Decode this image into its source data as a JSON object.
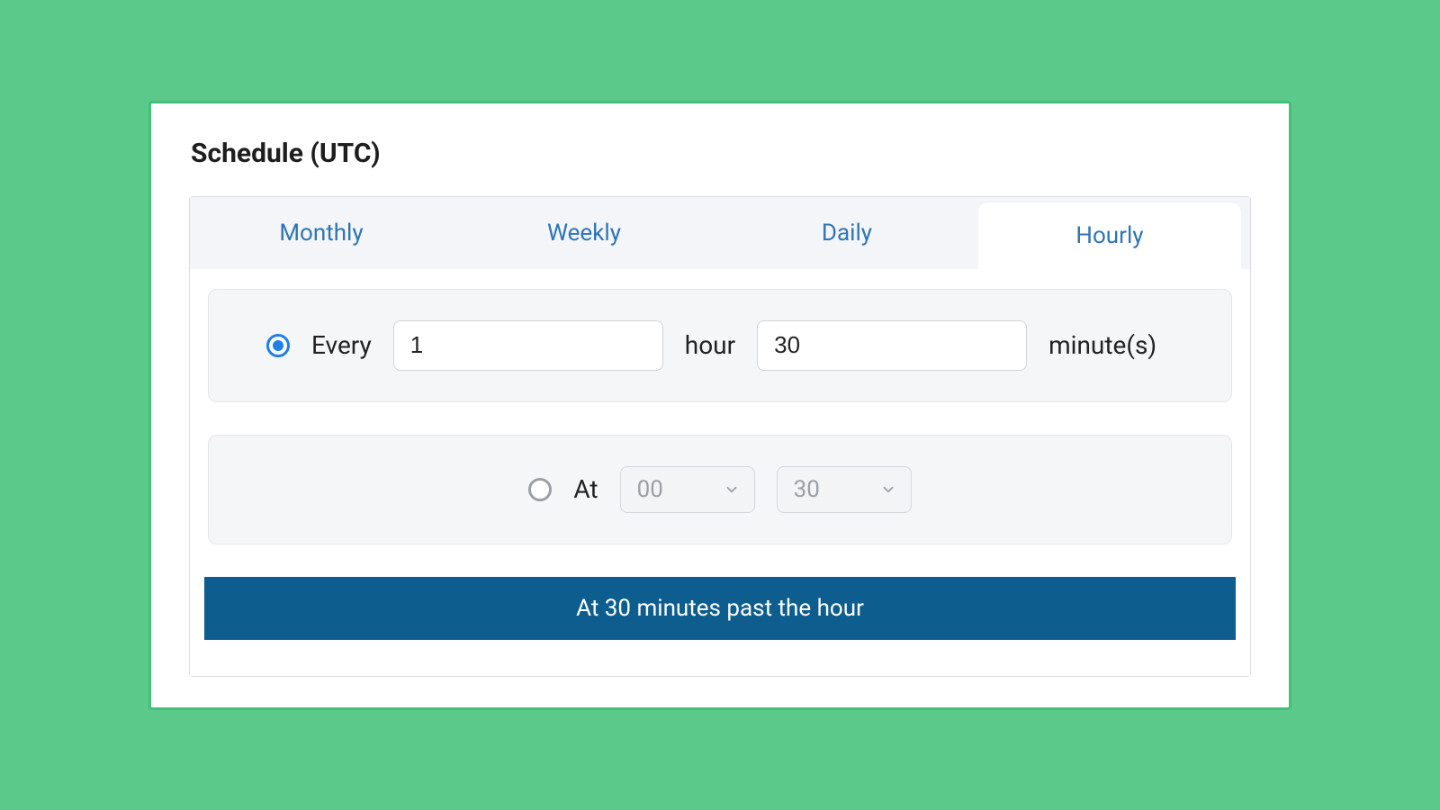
{
  "title": "Schedule (UTC)",
  "tabs": [
    {
      "label": "Monthly",
      "active": false
    },
    {
      "label": "Weekly",
      "active": false
    },
    {
      "label": "Daily",
      "active": false
    },
    {
      "label": "Hourly",
      "active": true
    }
  ],
  "every": {
    "selected": true,
    "label": "Every",
    "hours_value": "1",
    "hour_label": "hour",
    "minutes_value": "30",
    "minutes_label": "minute(s)"
  },
  "at": {
    "selected": false,
    "label": "At",
    "hour_value": "00",
    "minute_value": "30"
  },
  "summary": "At 30 minutes past the hour"
}
